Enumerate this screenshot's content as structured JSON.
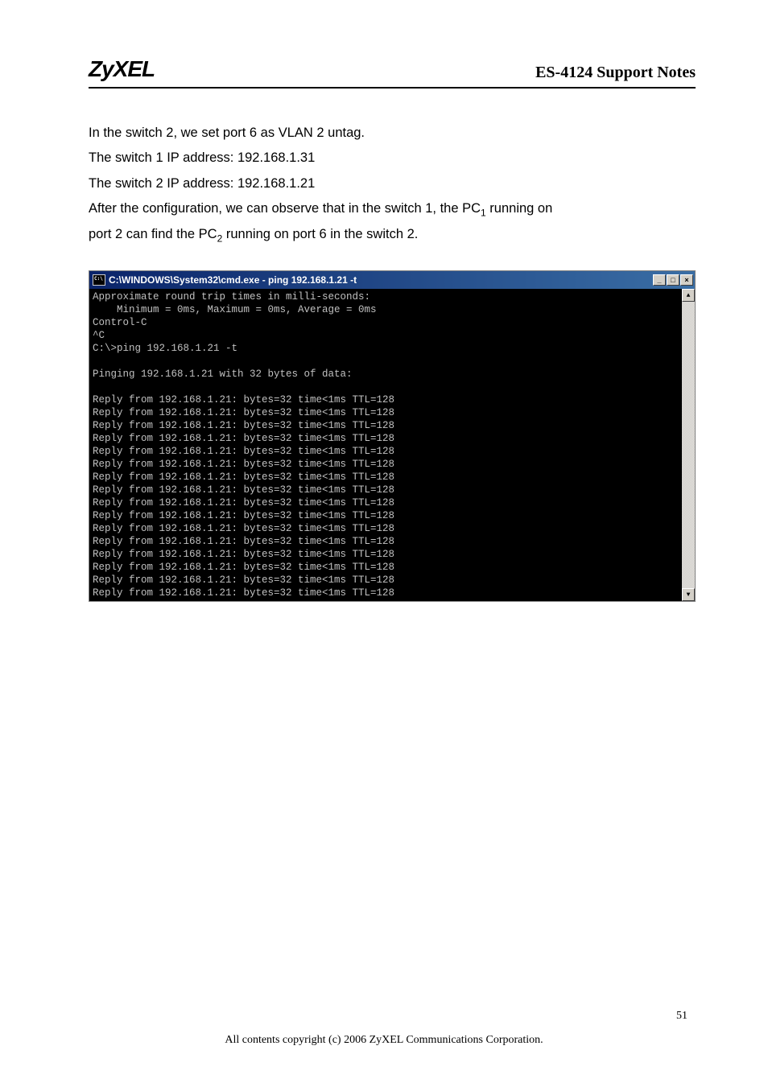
{
  "header": {
    "logo": "ZyXEL",
    "title": "ES-4124 Support Notes"
  },
  "body": {
    "line1": "In the switch 2, we set port 6 as VLAN 2 untag.",
    "line2": "The switch 1 IP address: 192.168.1.31",
    "line3": "The switch 2 IP address: 192.168.1.21",
    "line4a": "After the configuration, we can observe that in the switch 1, the PC",
    "line4b": " running on",
    "line5a": "port 2 can find the PC",
    "line5b": "   running on port 6 in the switch 2.",
    "sub1": "1",
    "sub2": "2"
  },
  "cmd": {
    "title": "C:\\WINDOWS\\System32\\cmd.exe - ping 192.168.1.21 -t",
    "minimize": "_",
    "maximize": "□",
    "close": "×",
    "scrollup": "▲",
    "scrolldown": "▼",
    "lines": [
      "Approximate round trip times in milli-seconds:",
      "    Minimum = 0ms, Maximum = 0ms, Average = 0ms",
      "Control-C",
      "^C",
      "C:\\>ping 192.168.1.21 -t",
      "",
      "Pinging 192.168.1.21 with 32 bytes of data:",
      "",
      "Reply from 192.168.1.21: bytes=32 time<1ms TTL=128",
      "Reply from 192.168.1.21: bytes=32 time<1ms TTL=128",
      "Reply from 192.168.1.21: bytes=32 time<1ms TTL=128",
      "Reply from 192.168.1.21: bytes=32 time<1ms TTL=128",
      "Reply from 192.168.1.21: bytes=32 time<1ms TTL=128",
      "Reply from 192.168.1.21: bytes=32 time<1ms TTL=128",
      "Reply from 192.168.1.21: bytes=32 time<1ms TTL=128",
      "Reply from 192.168.1.21: bytes=32 time<1ms TTL=128",
      "Reply from 192.168.1.21: bytes=32 time<1ms TTL=128",
      "Reply from 192.168.1.21: bytes=32 time<1ms TTL=128",
      "Reply from 192.168.1.21: bytes=32 time<1ms TTL=128",
      "Reply from 192.168.1.21: bytes=32 time<1ms TTL=128",
      "Reply from 192.168.1.21: bytes=32 time<1ms TTL=128",
      "Reply from 192.168.1.21: bytes=32 time<1ms TTL=128",
      "Reply from 192.168.1.21: bytes=32 time<1ms TTL=128",
      "Reply from 192.168.1.21: bytes=32 time<1ms TTL=128"
    ]
  },
  "footer": {
    "pagenum": "51",
    "copyright": "All contents copyright (c) 2006 ZyXEL Communications Corporation."
  }
}
